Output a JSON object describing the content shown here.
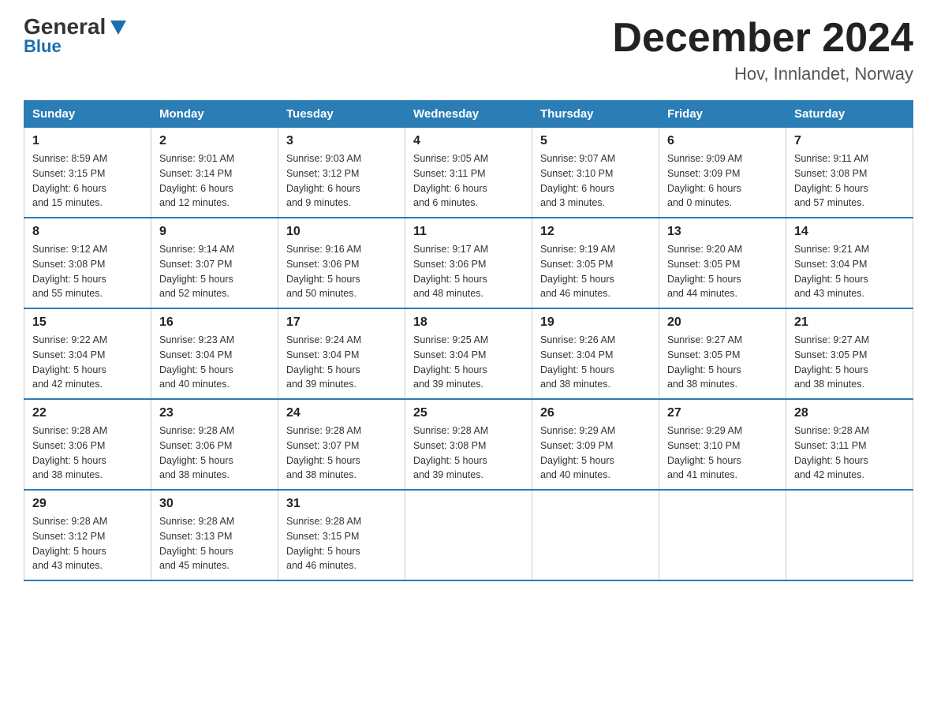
{
  "header": {
    "logo_general": "General",
    "logo_blue": "Blue",
    "month_title": "December 2024",
    "location": "Hov, Innlandet, Norway"
  },
  "weekdays": [
    "Sunday",
    "Monday",
    "Tuesday",
    "Wednesday",
    "Thursday",
    "Friday",
    "Saturday"
  ],
  "weeks": [
    [
      {
        "day": "1",
        "info": "Sunrise: 8:59 AM\nSunset: 3:15 PM\nDaylight: 6 hours\nand 15 minutes."
      },
      {
        "day": "2",
        "info": "Sunrise: 9:01 AM\nSunset: 3:14 PM\nDaylight: 6 hours\nand 12 minutes."
      },
      {
        "day": "3",
        "info": "Sunrise: 9:03 AM\nSunset: 3:12 PM\nDaylight: 6 hours\nand 9 minutes."
      },
      {
        "day": "4",
        "info": "Sunrise: 9:05 AM\nSunset: 3:11 PM\nDaylight: 6 hours\nand 6 minutes."
      },
      {
        "day": "5",
        "info": "Sunrise: 9:07 AM\nSunset: 3:10 PM\nDaylight: 6 hours\nand 3 minutes."
      },
      {
        "day": "6",
        "info": "Sunrise: 9:09 AM\nSunset: 3:09 PM\nDaylight: 6 hours\nand 0 minutes."
      },
      {
        "day": "7",
        "info": "Sunrise: 9:11 AM\nSunset: 3:08 PM\nDaylight: 5 hours\nand 57 minutes."
      }
    ],
    [
      {
        "day": "8",
        "info": "Sunrise: 9:12 AM\nSunset: 3:08 PM\nDaylight: 5 hours\nand 55 minutes."
      },
      {
        "day": "9",
        "info": "Sunrise: 9:14 AM\nSunset: 3:07 PM\nDaylight: 5 hours\nand 52 minutes."
      },
      {
        "day": "10",
        "info": "Sunrise: 9:16 AM\nSunset: 3:06 PM\nDaylight: 5 hours\nand 50 minutes."
      },
      {
        "day": "11",
        "info": "Sunrise: 9:17 AM\nSunset: 3:06 PM\nDaylight: 5 hours\nand 48 minutes."
      },
      {
        "day": "12",
        "info": "Sunrise: 9:19 AM\nSunset: 3:05 PM\nDaylight: 5 hours\nand 46 minutes."
      },
      {
        "day": "13",
        "info": "Sunrise: 9:20 AM\nSunset: 3:05 PM\nDaylight: 5 hours\nand 44 minutes."
      },
      {
        "day": "14",
        "info": "Sunrise: 9:21 AM\nSunset: 3:04 PM\nDaylight: 5 hours\nand 43 minutes."
      }
    ],
    [
      {
        "day": "15",
        "info": "Sunrise: 9:22 AM\nSunset: 3:04 PM\nDaylight: 5 hours\nand 42 minutes."
      },
      {
        "day": "16",
        "info": "Sunrise: 9:23 AM\nSunset: 3:04 PM\nDaylight: 5 hours\nand 40 minutes."
      },
      {
        "day": "17",
        "info": "Sunrise: 9:24 AM\nSunset: 3:04 PM\nDaylight: 5 hours\nand 39 minutes."
      },
      {
        "day": "18",
        "info": "Sunrise: 9:25 AM\nSunset: 3:04 PM\nDaylight: 5 hours\nand 39 minutes."
      },
      {
        "day": "19",
        "info": "Sunrise: 9:26 AM\nSunset: 3:04 PM\nDaylight: 5 hours\nand 38 minutes."
      },
      {
        "day": "20",
        "info": "Sunrise: 9:27 AM\nSunset: 3:05 PM\nDaylight: 5 hours\nand 38 minutes."
      },
      {
        "day": "21",
        "info": "Sunrise: 9:27 AM\nSunset: 3:05 PM\nDaylight: 5 hours\nand 38 minutes."
      }
    ],
    [
      {
        "day": "22",
        "info": "Sunrise: 9:28 AM\nSunset: 3:06 PM\nDaylight: 5 hours\nand 38 minutes."
      },
      {
        "day": "23",
        "info": "Sunrise: 9:28 AM\nSunset: 3:06 PM\nDaylight: 5 hours\nand 38 minutes."
      },
      {
        "day": "24",
        "info": "Sunrise: 9:28 AM\nSunset: 3:07 PM\nDaylight: 5 hours\nand 38 minutes."
      },
      {
        "day": "25",
        "info": "Sunrise: 9:28 AM\nSunset: 3:08 PM\nDaylight: 5 hours\nand 39 minutes."
      },
      {
        "day": "26",
        "info": "Sunrise: 9:29 AM\nSunset: 3:09 PM\nDaylight: 5 hours\nand 40 minutes."
      },
      {
        "day": "27",
        "info": "Sunrise: 9:29 AM\nSunset: 3:10 PM\nDaylight: 5 hours\nand 41 minutes."
      },
      {
        "day": "28",
        "info": "Sunrise: 9:28 AM\nSunset: 3:11 PM\nDaylight: 5 hours\nand 42 minutes."
      }
    ],
    [
      {
        "day": "29",
        "info": "Sunrise: 9:28 AM\nSunset: 3:12 PM\nDaylight: 5 hours\nand 43 minutes."
      },
      {
        "day": "30",
        "info": "Sunrise: 9:28 AM\nSunset: 3:13 PM\nDaylight: 5 hours\nand 45 minutes."
      },
      {
        "day": "31",
        "info": "Sunrise: 9:28 AM\nSunset: 3:15 PM\nDaylight: 5 hours\nand 46 minutes."
      },
      {
        "day": "",
        "info": ""
      },
      {
        "day": "",
        "info": ""
      },
      {
        "day": "",
        "info": ""
      },
      {
        "day": "",
        "info": ""
      }
    ]
  ]
}
